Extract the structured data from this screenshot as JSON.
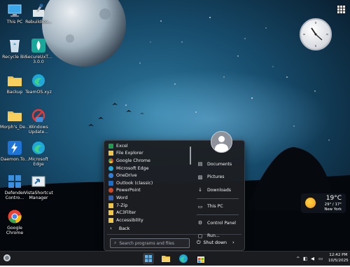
{
  "desktop_icons": [
    {
      "label": "This PC",
      "icon": "this-pc-icon"
    },
    {
      "label": "RebuildIco...",
      "icon": "rebuild-icon"
    },
    {
      "label": "Recycle Bin",
      "icon": "recycle-bin-icon"
    },
    {
      "label": "SecureUxT...",
      "label2": "3.0.0",
      "icon": "secureux-icon"
    },
    {
      "label": "Backup",
      "icon": "folder-icon"
    },
    {
      "label": "TeamOS.xyz",
      "icon": "edge-icon"
    },
    {
      "label": "Morph's_De...",
      "icon": "folder-icon"
    },
    {
      "label": "Windows",
      "label2": "Update...",
      "icon": "windows-update-icon"
    },
    {
      "label": "Daemon.To...",
      "icon": "daemon-tools-icon"
    },
    {
      "label": "Microsoft",
      "label2": "Edge",
      "icon": "edge-icon"
    },
    {
      "label": "Defender",
      "label2": "Contro...",
      "icon": "defender-icon"
    },
    {
      "label": "VistaShortcut",
      "label2": "Manager",
      "icon": "shortcut-icon"
    },
    {
      "label": "Google",
      "label2": "Chrome",
      "icon": "chrome-icon"
    }
  ],
  "start_menu": {
    "programs": [
      {
        "label": "Excel",
        "color": "#1d9c50"
      },
      {
        "label": "File Explorer",
        "color": "#f2c744"
      },
      {
        "label": "Google Chrome",
        "color": "#3f8ee8"
      },
      {
        "label": "Microsoft Edge",
        "color": "#1fa7d8"
      },
      {
        "label": "OneDrive",
        "color": "#2f7fd8"
      },
      {
        "label": "Outlook (classic)",
        "color": "#1c6ec8"
      },
      {
        "label": "PowerPoint",
        "color": "#d24726"
      },
      {
        "label": "Word",
        "color": "#2b5fb8"
      },
      {
        "label": "7-Zip",
        "color": "#555a60"
      },
      {
        "label": "AC3Filter",
        "color": "#f0c030"
      },
      {
        "label": "Accessibility",
        "color": "#f0c030"
      }
    ],
    "back_label": "Back",
    "search_placeholder": "Search programs and files",
    "places": [
      {
        "label": "Documents",
        "glyph": "🗎"
      },
      {
        "label": "Pictures",
        "glyph": "🖼"
      },
      {
        "label": "Downloads",
        "glyph": "⭳"
      },
      {
        "label": "This PC",
        "glyph": "🖥"
      },
      {
        "label": "Control Panel",
        "glyph": "🛠"
      },
      {
        "label": "Run...",
        "glyph": "▭"
      }
    ],
    "shutdown_label": "Shut down"
  },
  "weather": {
    "temp": "19°C",
    "range": "29° / 17°",
    "location": "New York"
  },
  "taskbar": {
    "time": "12:42 PM",
    "date": "10/5/2025"
  },
  "colors": {
    "taskbar": "#1b1c20",
    "start_menu": "#1c1e22",
    "accent": "#1fa7d8"
  }
}
